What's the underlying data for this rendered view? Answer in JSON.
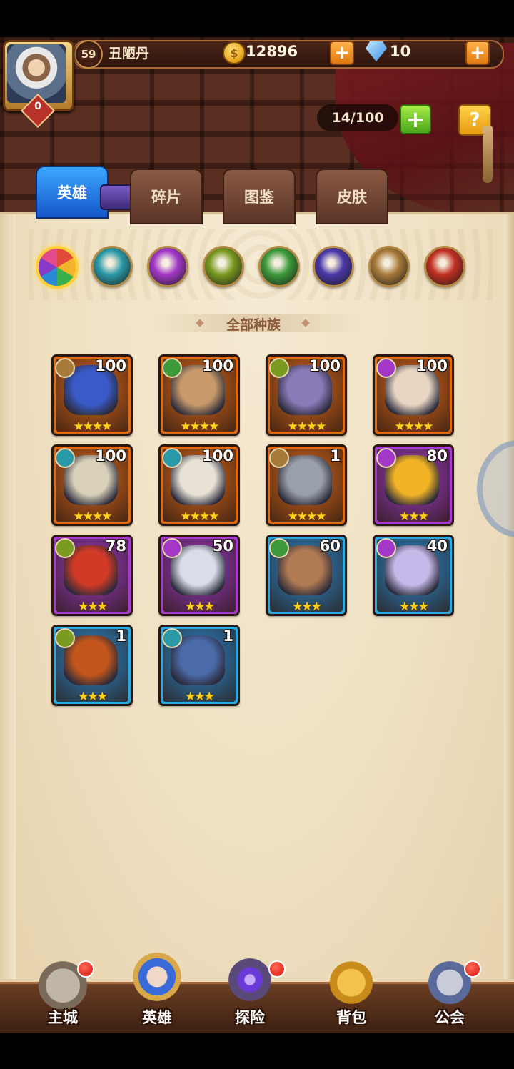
{
  "player": {
    "level": "59",
    "name": "丑陋丹",
    "badge": "0"
  },
  "currency": {
    "gold": "12896",
    "gems": "10",
    "add_label": "+"
  },
  "capacity": {
    "text": "14/100",
    "add_label": "+",
    "help_label": "?"
  },
  "tabs": [
    {
      "label": "英雄",
      "active": true
    },
    {
      "label": "碎片",
      "active": false
    },
    {
      "label": "图鉴",
      "active": false
    },
    {
      "label": "皮肤",
      "active": false
    }
  ],
  "race_filters": [
    {
      "name": "all",
      "color": "#e24a3a",
      "active": true
    },
    {
      "name": "water",
      "color": "#2a9aa8",
      "active": false
    },
    {
      "name": "shadow",
      "color": "#a338c8",
      "active": false
    },
    {
      "name": "eye",
      "color": "#7a9a20",
      "active": false
    },
    {
      "name": "forest",
      "color": "#3c9a3a",
      "active": false
    },
    {
      "name": "demon",
      "color": "#4a38a8",
      "active": false
    },
    {
      "name": "light",
      "color": "#a87a3a",
      "active": false
    },
    {
      "name": "fire",
      "color": "#c23022",
      "active": false
    }
  ],
  "race_title": "全部种族",
  "heroes": [
    {
      "level": "100",
      "stars": "★★★★",
      "race": "light",
      "frame": "#e06a10",
      "bg": "#d8661a",
      "skin": "#3a5ac8"
    },
    {
      "level": "100",
      "stars": "★★★★",
      "race": "forest",
      "frame": "#e06a10",
      "bg": "#d8661a",
      "skin": "#c89a6a"
    },
    {
      "level": "100",
      "stars": "★★★★",
      "race": "eye",
      "frame": "#e06a10",
      "bg": "#d8661a",
      "skin": "#8a7ab8"
    },
    {
      "level": "100",
      "stars": "★★★★",
      "race": "shadow",
      "frame": "#e06a10",
      "bg": "#d8661a",
      "skin": "#e8d6c2"
    },
    {
      "level": "100",
      "stars": "★★★★",
      "race": "water",
      "frame": "#e06a10",
      "bg": "#d8661a",
      "skin": "#d8d0b8"
    },
    {
      "level": "100",
      "stars": "★★★★",
      "race": "water",
      "frame": "#e06a10",
      "bg": "#d8661a",
      "skin": "#e8e2d6"
    },
    {
      "level": "1",
      "stars": "★★★★",
      "race": "light",
      "frame": "#e06a10",
      "bg": "#d8661a",
      "skin": "#9aa0aa"
    },
    {
      "level": "80",
      "stars": "★★★",
      "race": "shadow",
      "frame": "#a83ad2",
      "bg": "#9c3ac4",
      "skin": "#f2b426"
    },
    {
      "level": "78",
      "stars": "★★★",
      "race": "eye",
      "frame": "#a83ad2",
      "bg": "#9c3ac4",
      "skin": "#d03a26"
    },
    {
      "level": "50",
      "stars": "★★★",
      "race": "shadow",
      "frame": "#a83ad2",
      "bg": "#9c3ac4",
      "skin": "#d8dde8"
    },
    {
      "level": "60",
      "stars": "★★★",
      "race": "forest",
      "frame": "#2aa8e0",
      "bg": "#2a8ad0",
      "skin": "#b07a52"
    },
    {
      "level": "40",
      "stars": "★★★",
      "race": "shadow",
      "frame": "#2aa8e0",
      "bg": "#2a8ad0",
      "skin": "#c6b8e8"
    },
    {
      "level": "1",
      "stars": "★★★",
      "race": "eye",
      "frame": "#2aa8e0",
      "bg": "#2a8ad0",
      "skin": "#c2561c"
    },
    {
      "level": "1",
      "stars": "★★★",
      "race": "water",
      "frame": "#2aa8e0",
      "bg": "#2a8ad0",
      "skin": "#4a6aa8"
    }
  ],
  "nav": [
    {
      "label": "主城",
      "icon": "castle-icon",
      "dot": true
    },
    {
      "label": "英雄",
      "icon": "hero-portrait-icon",
      "dot": false
    },
    {
      "label": "探险",
      "icon": "portal-icon",
      "dot": true
    },
    {
      "label": "背包",
      "icon": "backpack-icon",
      "dot": false
    },
    {
      "label": "公会",
      "icon": "guild-tower-icon",
      "dot": true
    }
  ]
}
